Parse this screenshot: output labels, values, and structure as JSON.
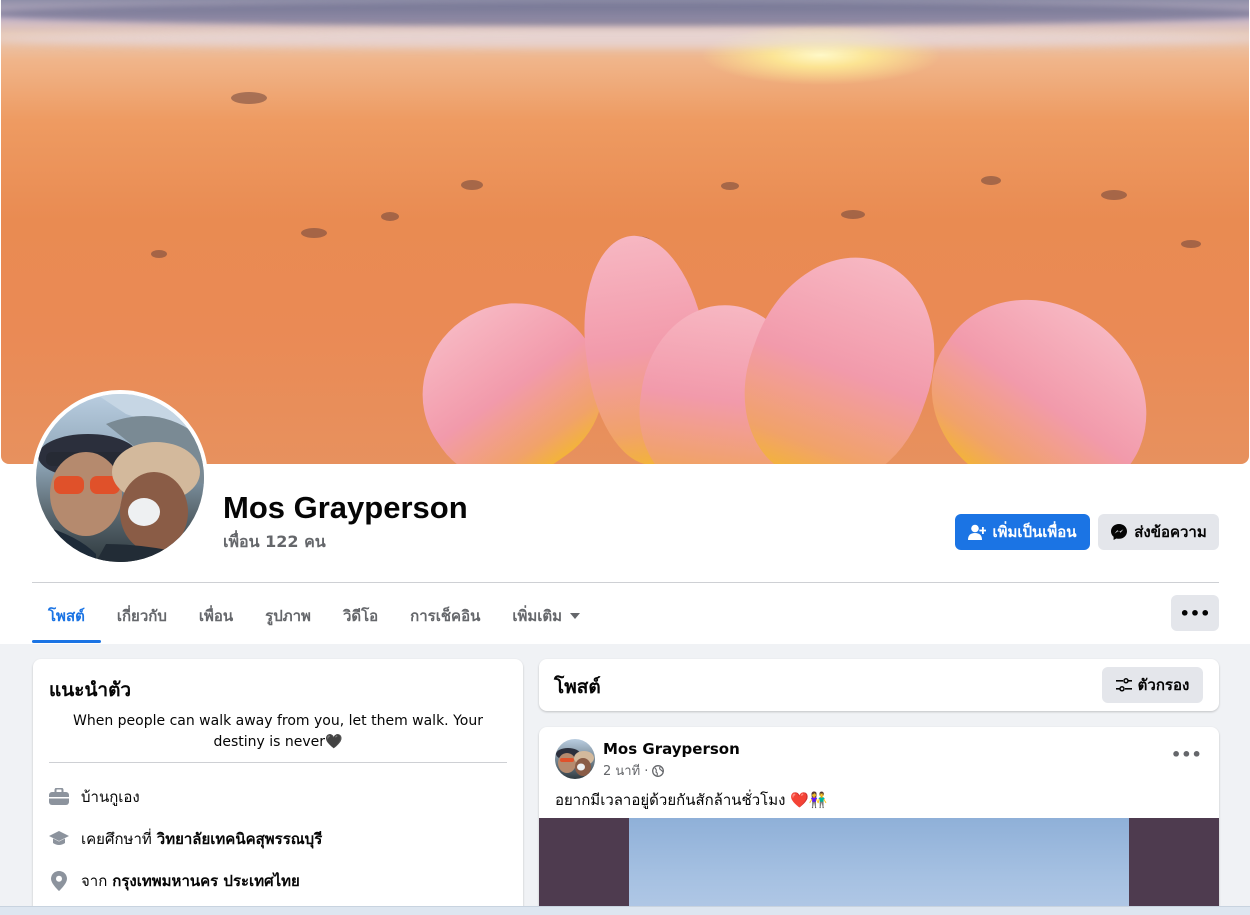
{
  "profile": {
    "name": "Mos Grayperson",
    "friends_count": "เพื่อน 122 คน"
  },
  "actions": {
    "add_friend": "เพิ่มเป็นเพื่อน",
    "message": "ส่งข้อความ",
    "more": "•••"
  },
  "tabs": [
    {
      "label": "โพสต์",
      "active": true
    },
    {
      "label": "เกี่ยวกับ"
    },
    {
      "label": "เพื่อน"
    },
    {
      "label": "รูปภาพ"
    },
    {
      "label": "วิดีโอ"
    },
    {
      "label": "การเช็คอิน"
    },
    {
      "label": "เพิ่มเติม"
    }
  ],
  "intro": {
    "title": "แนะนำตัว",
    "bio": "When people can walk away from you, let them walk. Your destiny is never🖤",
    "work": "บ้านกูเอง",
    "education_prefix": "เคยศึกษาที่",
    "education_value": "วิทยาลัยเทคนิคสุพรรณบุรี",
    "from_prefix": "จาก",
    "from_value": "กรุงเทพมหานคร ประเทศไทย"
  },
  "posts_section": {
    "title": "โพสต์",
    "filter_label": "ตัวกรอง"
  },
  "post": {
    "author": "Mos Grayperson",
    "time": "2 นาที ·",
    "text": "อยากมีเวลาอยู่ด้วยกันสักล้านชั่วโมง ❤️👫",
    "more": "•••"
  },
  "colors": {
    "accent": "#1b74e4",
    "secondary_button": "#e4e6eb",
    "page_bg": "#f0f2f5",
    "muted_text": "#65676b"
  }
}
